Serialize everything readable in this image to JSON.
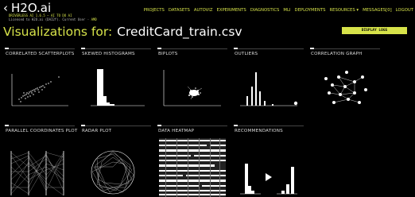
{
  "header": {
    "back_icon": "chevron-left-icon",
    "brand": "H2O.ai",
    "version_line": "DRIVERLESS AI 1.6.5 — AI TO DO AI",
    "license_prefix": "Licensed to H2O.ai (DAI2f). Current User -",
    "user": "AMD"
  },
  "nav": [
    "PROJECTS",
    "DATASETS",
    "AUTOVIZ",
    "EXPERIMENTS",
    "DIAGNOSTICS",
    "MLI",
    "DEPLOYMENTS",
    "RESOURCES ▾",
    "MESSAGES[0]",
    "LOGOUT"
  ],
  "page": {
    "title": "Visualizations for:",
    "dataset": "CreditCard_train.csv",
    "display_logs": "DISPLAY LOGS"
  },
  "cards": [
    {
      "label": "CORRELATED SCATTERPLOTS",
      "icon": "scatterplot-thumbnail"
    },
    {
      "label": "SKEWED HISTOGRAMS",
      "icon": "histogram-thumbnail"
    },
    {
      "label": "BIPLOTS",
      "icon": "biplot-thumbnail"
    },
    {
      "label": "OUTLIERS",
      "icon": "outliers-thumbnail"
    },
    {
      "label": "CORRELATION GRAPH",
      "icon": "network-graph-thumbnail"
    },
    {
      "label": "PARALLEL COORDINATES PLOT",
      "icon": "parallel-coordinates-thumbnail"
    },
    {
      "label": "RADAR PLOT",
      "icon": "radar-plot-thumbnail"
    },
    {
      "label": "DATA HEATMAP",
      "icon": "heatmap-thumbnail"
    },
    {
      "label": "RECOMMENDATIONS",
      "icon": "recommendations-thumbnail"
    }
  ],
  "colors": {
    "accent": "#d7e34a",
    "background": "#000000",
    "text": "#ffffff"
  }
}
